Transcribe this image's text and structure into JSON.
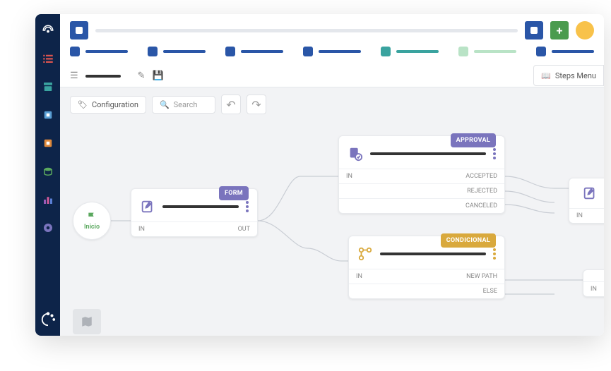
{
  "sidebar": {
    "items": [
      "dashboard",
      "list",
      "archive",
      "module-a",
      "module-b",
      "finance",
      "analytics",
      "settings"
    ]
  },
  "topbar": {
    "add_label": "+",
    "tabs": [
      {
        "color": "#2a56a7"
      },
      {
        "color": "#2a56a7"
      },
      {
        "color": "#2a56a7"
      },
      {
        "color": "#2a56a7"
      },
      {
        "color": "#3aa39f"
      },
      {
        "color": "#b9e3c6"
      },
      {
        "color": "#2a56a7"
      }
    ]
  },
  "workspace": {
    "config_label": "Configuration",
    "search_placeholder": "Search",
    "steps_menu_label": "Steps Menu"
  },
  "nodes": {
    "start": {
      "label": "Inicio"
    },
    "form": {
      "tag": "FORM",
      "tag_color": "#7a74bd",
      "in": "IN",
      "out": "OUT"
    },
    "approval": {
      "tag": "APPROVAL",
      "tag_color": "#7a74bd",
      "in": "IN",
      "outcomes": [
        "ACCEPTED",
        "REJECTED",
        "CANCELED"
      ]
    },
    "conditional": {
      "tag": "CONDICIONAL",
      "tag_color": "#d9a93d",
      "in": "IN",
      "outcomes": [
        "NEW PATH",
        "ELSE"
      ]
    },
    "edit_mini": {
      "in": "IN"
    },
    "right_mini": {
      "in": "IN"
    }
  }
}
